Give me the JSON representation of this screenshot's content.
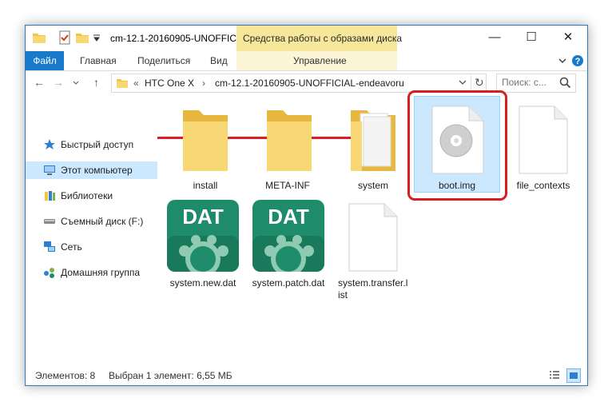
{
  "titlebar": {
    "title": "cm-12.1-20160905-UNOFFIC...",
    "context_tab": "Средства работы с образами диска",
    "minimize": "—",
    "maximize": "☐",
    "close": "✕"
  },
  "ribbon": {
    "tabs": [
      "Файл",
      "Главная",
      "Поделиться",
      "Вид",
      "Управление"
    ]
  },
  "navigation": {
    "back": "←",
    "forward": "→",
    "up": "↑",
    "breadcrumb_overflow": "«",
    "breadcrumb": [
      "HTC One X",
      "cm-12.1-20160905-UNOFFICIAL-endeavoru"
    ],
    "separator": "›",
    "refresh": "↻",
    "search_placeholder": "Поиск: с..."
  },
  "sidebar": {
    "items": [
      {
        "label": "Быстрый доступ",
        "icon": "star-icon"
      },
      {
        "label": "Этот компьютер",
        "icon": "computer-icon"
      },
      {
        "label": "Библиотеки",
        "icon": "library-icon"
      },
      {
        "label": "Съемный диск (F:)",
        "icon": "removable-drive-icon"
      },
      {
        "label": "Сеть",
        "icon": "network-icon"
      },
      {
        "label": "Домашняя группа",
        "icon": "homegroup-icon"
      }
    ],
    "selected": "Этот компьютер"
  },
  "files": [
    {
      "name": "install",
      "type": "folder"
    },
    {
      "name": "META-INF",
      "type": "folder"
    },
    {
      "name": "system",
      "type": "folder-documents"
    },
    {
      "name": "boot.img",
      "type": "disc-image",
      "selected": true
    },
    {
      "name": "file_contexts",
      "type": "file"
    },
    {
      "name": "system.new.dat",
      "type": "dat"
    },
    {
      "name": "system.patch.dat",
      "type": "dat"
    },
    {
      "name": "system.transfer.list",
      "type": "file"
    }
  ],
  "dat_icon_label": "DAT",
  "status": {
    "items": "Элементов: 8",
    "selection": "Выбран 1 элемент: 6,55 МБ"
  },
  "colors": {
    "accent": "#1979ca",
    "context_tab": "#f7e79a",
    "selection": "#cce8ff",
    "highlight": "#d81e1e",
    "folder": "#f8d775",
    "dat": "#1e8c6a"
  }
}
